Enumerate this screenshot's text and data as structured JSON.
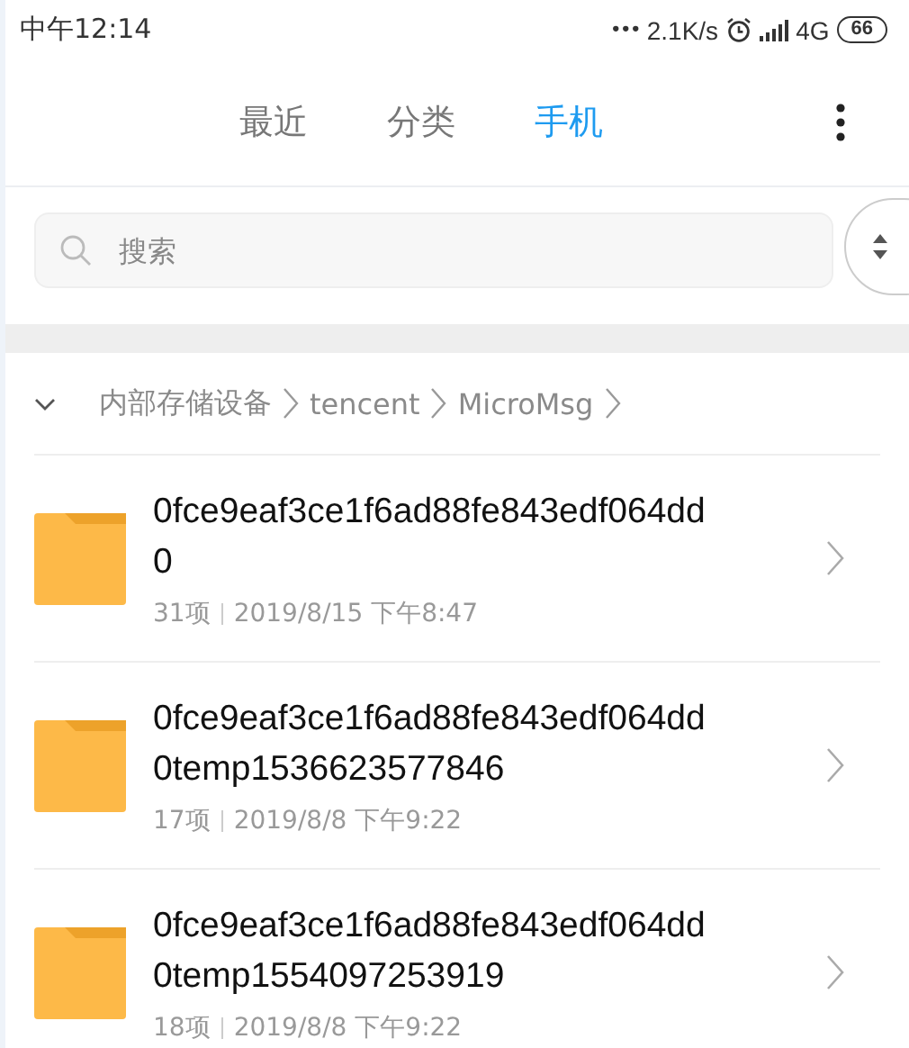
{
  "status_bar": {
    "time": "中午12:14",
    "dots": "•••",
    "speed": "2.1K/s",
    "network": "4G",
    "battery": "66"
  },
  "tabs": [
    {
      "label": "最近",
      "selected": false
    },
    {
      "label": "分类",
      "selected": false
    },
    {
      "label": "手机",
      "selected": true
    }
  ],
  "search": {
    "placeholder": "搜索"
  },
  "breadcrumb": {
    "expanded": true,
    "parts": [
      "内部存储设备",
      "tencent",
      "MicroMsg"
    ]
  },
  "folders": [
    {
      "name_lines": [
        "0fce9eaf3ce1f6ad88fe843edf064dd",
        "0"
      ],
      "count": "31项",
      "date": "2019/8/15 下午8:47"
    },
    {
      "name_lines": [
        "0fce9eaf3ce1f6ad88fe843edf064dd",
        "0temp1536623577846"
      ],
      "count": "17项",
      "date": "2019/8/8 下午9:22"
    },
    {
      "name_lines": [
        "0fce9eaf3ce1f6ad88fe843edf064dd",
        "0temp1554097253919"
      ],
      "count": "18项",
      "date": "2019/8/8 下午9:22"
    }
  ]
}
